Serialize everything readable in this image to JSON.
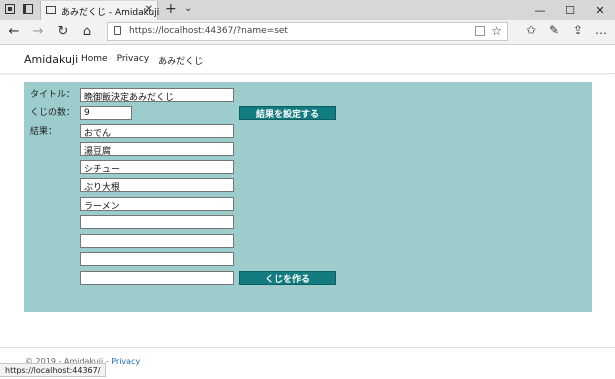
{
  "browser": {
    "tab_title": "あみだくじ - Amidakuji",
    "new_tab_glyph": "+",
    "tab_menu_glyph": "⌄",
    "tab_close_glyph": "✕",
    "window_controls": [
      "—",
      "☐",
      "✕"
    ],
    "url": "https://localhost:44367/?name=set",
    "status_url": "https://localhost:44367/"
  },
  "site": {
    "brand": "Amidakuji",
    "nav": [
      "Home",
      "Privacy",
      "あみだくじ"
    ]
  },
  "form": {
    "title_label": "タイトル：",
    "title_value": "晩御飯決定あみだくじ",
    "count_label": "くじの数：",
    "count_value": "9",
    "set_results_button": "結果を設定する",
    "results_label": "結果：",
    "results": [
      "おでん",
      "湯豆腐",
      "シチュー",
      "ぶり大根",
      "ラーメン",
      "",
      "",
      "",
      ""
    ],
    "make_lottery_button": "くじを作る"
  },
  "footer": {
    "copyright": "© 2019 - Amidakuji -",
    "privacy_link": "Privacy"
  },
  "colors": {
    "panel_bg": "#9dcccc",
    "button_bg": "#127c80",
    "link": "#1a6fb5"
  }
}
